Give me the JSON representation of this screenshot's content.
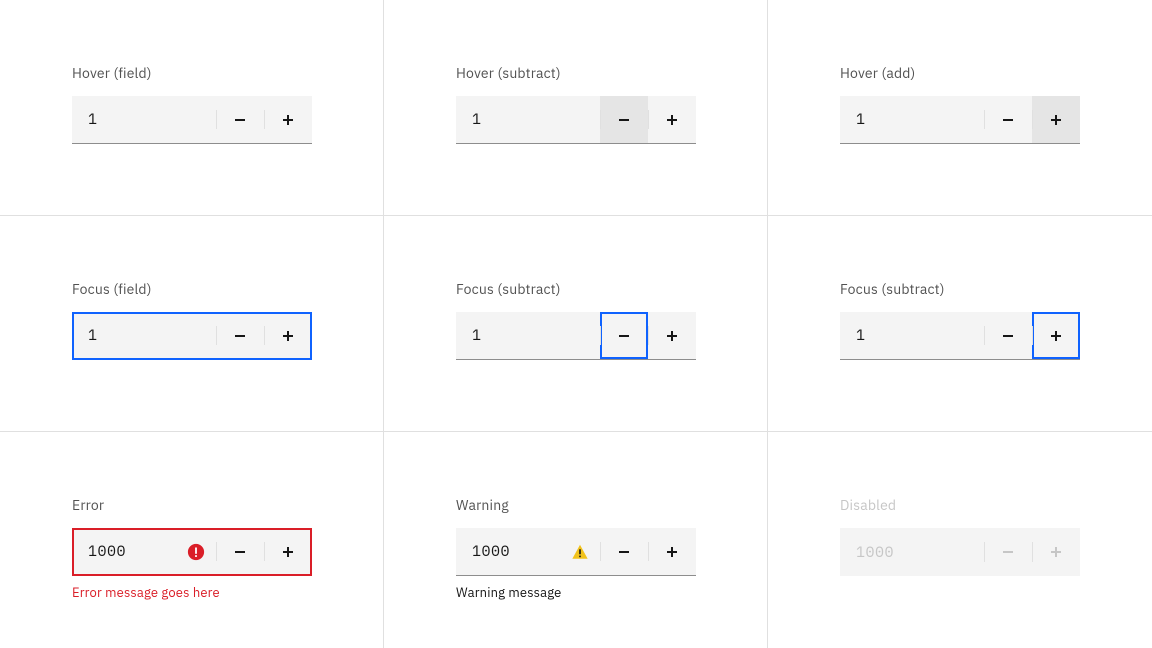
{
  "items": [
    {
      "label": "Hover (field)",
      "value": "1",
      "status": null,
      "helper": null,
      "helperKind": null,
      "fieldFocus": false,
      "fieldError": false,
      "disabled": false,
      "subHover": false,
      "addHover": false,
      "subFocus": false,
      "addFocus": false
    },
    {
      "label": "Hover (subtract)",
      "value": "1",
      "status": null,
      "helper": null,
      "helperKind": null,
      "fieldFocus": false,
      "fieldError": false,
      "disabled": false,
      "subHover": true,
      "addHover": false,
      "subFocus": false,
      "addFocus": false
    },
    {
      "label": "Hover (add)",
      "value": "1",
      "status": null,
      "helper": null,
      "helperKind": null,
      "fieldFocus": false,
      "fieldError": false,
      "disabled": false,
      "subHover": false,
      "addHover": true,
      "subFocus": false,
      "addFocus": false
    },
    {
      "label": "Focus (field)",
      "value": "1",
      "status": null,
      "helper": null,
      "helperKind": null,
      "fieldFocus": true,
      "fieldError": false,
      "disabled": false,
      "subHover": false,
      "addHover": false,
      "subFocus": false,
      "addFocus": false
    },
    {
      "label": "Focus (subtract)",
      "value": "1",
      "status": null,
      "helper": null,
      "helperKind": null,
      "fieldFocus": false,
      "fieldError": false,
      "disabled": false,
      "subHover": false,
      "addHover": false,
      "subFocus": true,
      "addFocus": false
    },
    {
      "label": "Focus (subtract)",
      "value": "1",
      "status": null,
      "helper": null,
      "helperKind": null,
      "fieldFocus": false,
      "fieldError": false,
      "disabled": false,
      "subHover": false,
      "addHover": false,
      "subFocus": false,
      "addFocus": true
    },
    {
      "label": "Error",
      "value": "1000",
      "status": "error",
      "helper": "Error message goes here",
      "helperKind": "error",
      "fieldFocus": false,
      "fieldError": true,
      "disabled": false,
      "subHover": false,
      "addHover": false,
      "subFocus": false,
      "addFocus": false
    },
    {
      "label": "Warning",
      "value": "1000",
      "status": "warning",
      "helper": "Warning message",
      "helperKind": "warning",
      "fieldFocus": false,
      "fieldError": false,
      "disabled": false,
      "subHover": false,
      "addHover": false,
      "subFocus": false,
      "addFocus": false
    },
    {
      "label": "Disabled",
      "value": "1000",
      "status": null,
      "helper": null,
      "helperKind": null,
      "fieldFocus": false,
      "fieldError": false,
      "disabled": true,
      "subHover": false,
      "addHover": false,
      "subFocus": false,
      "addFocus": false
    }
  ]
}
